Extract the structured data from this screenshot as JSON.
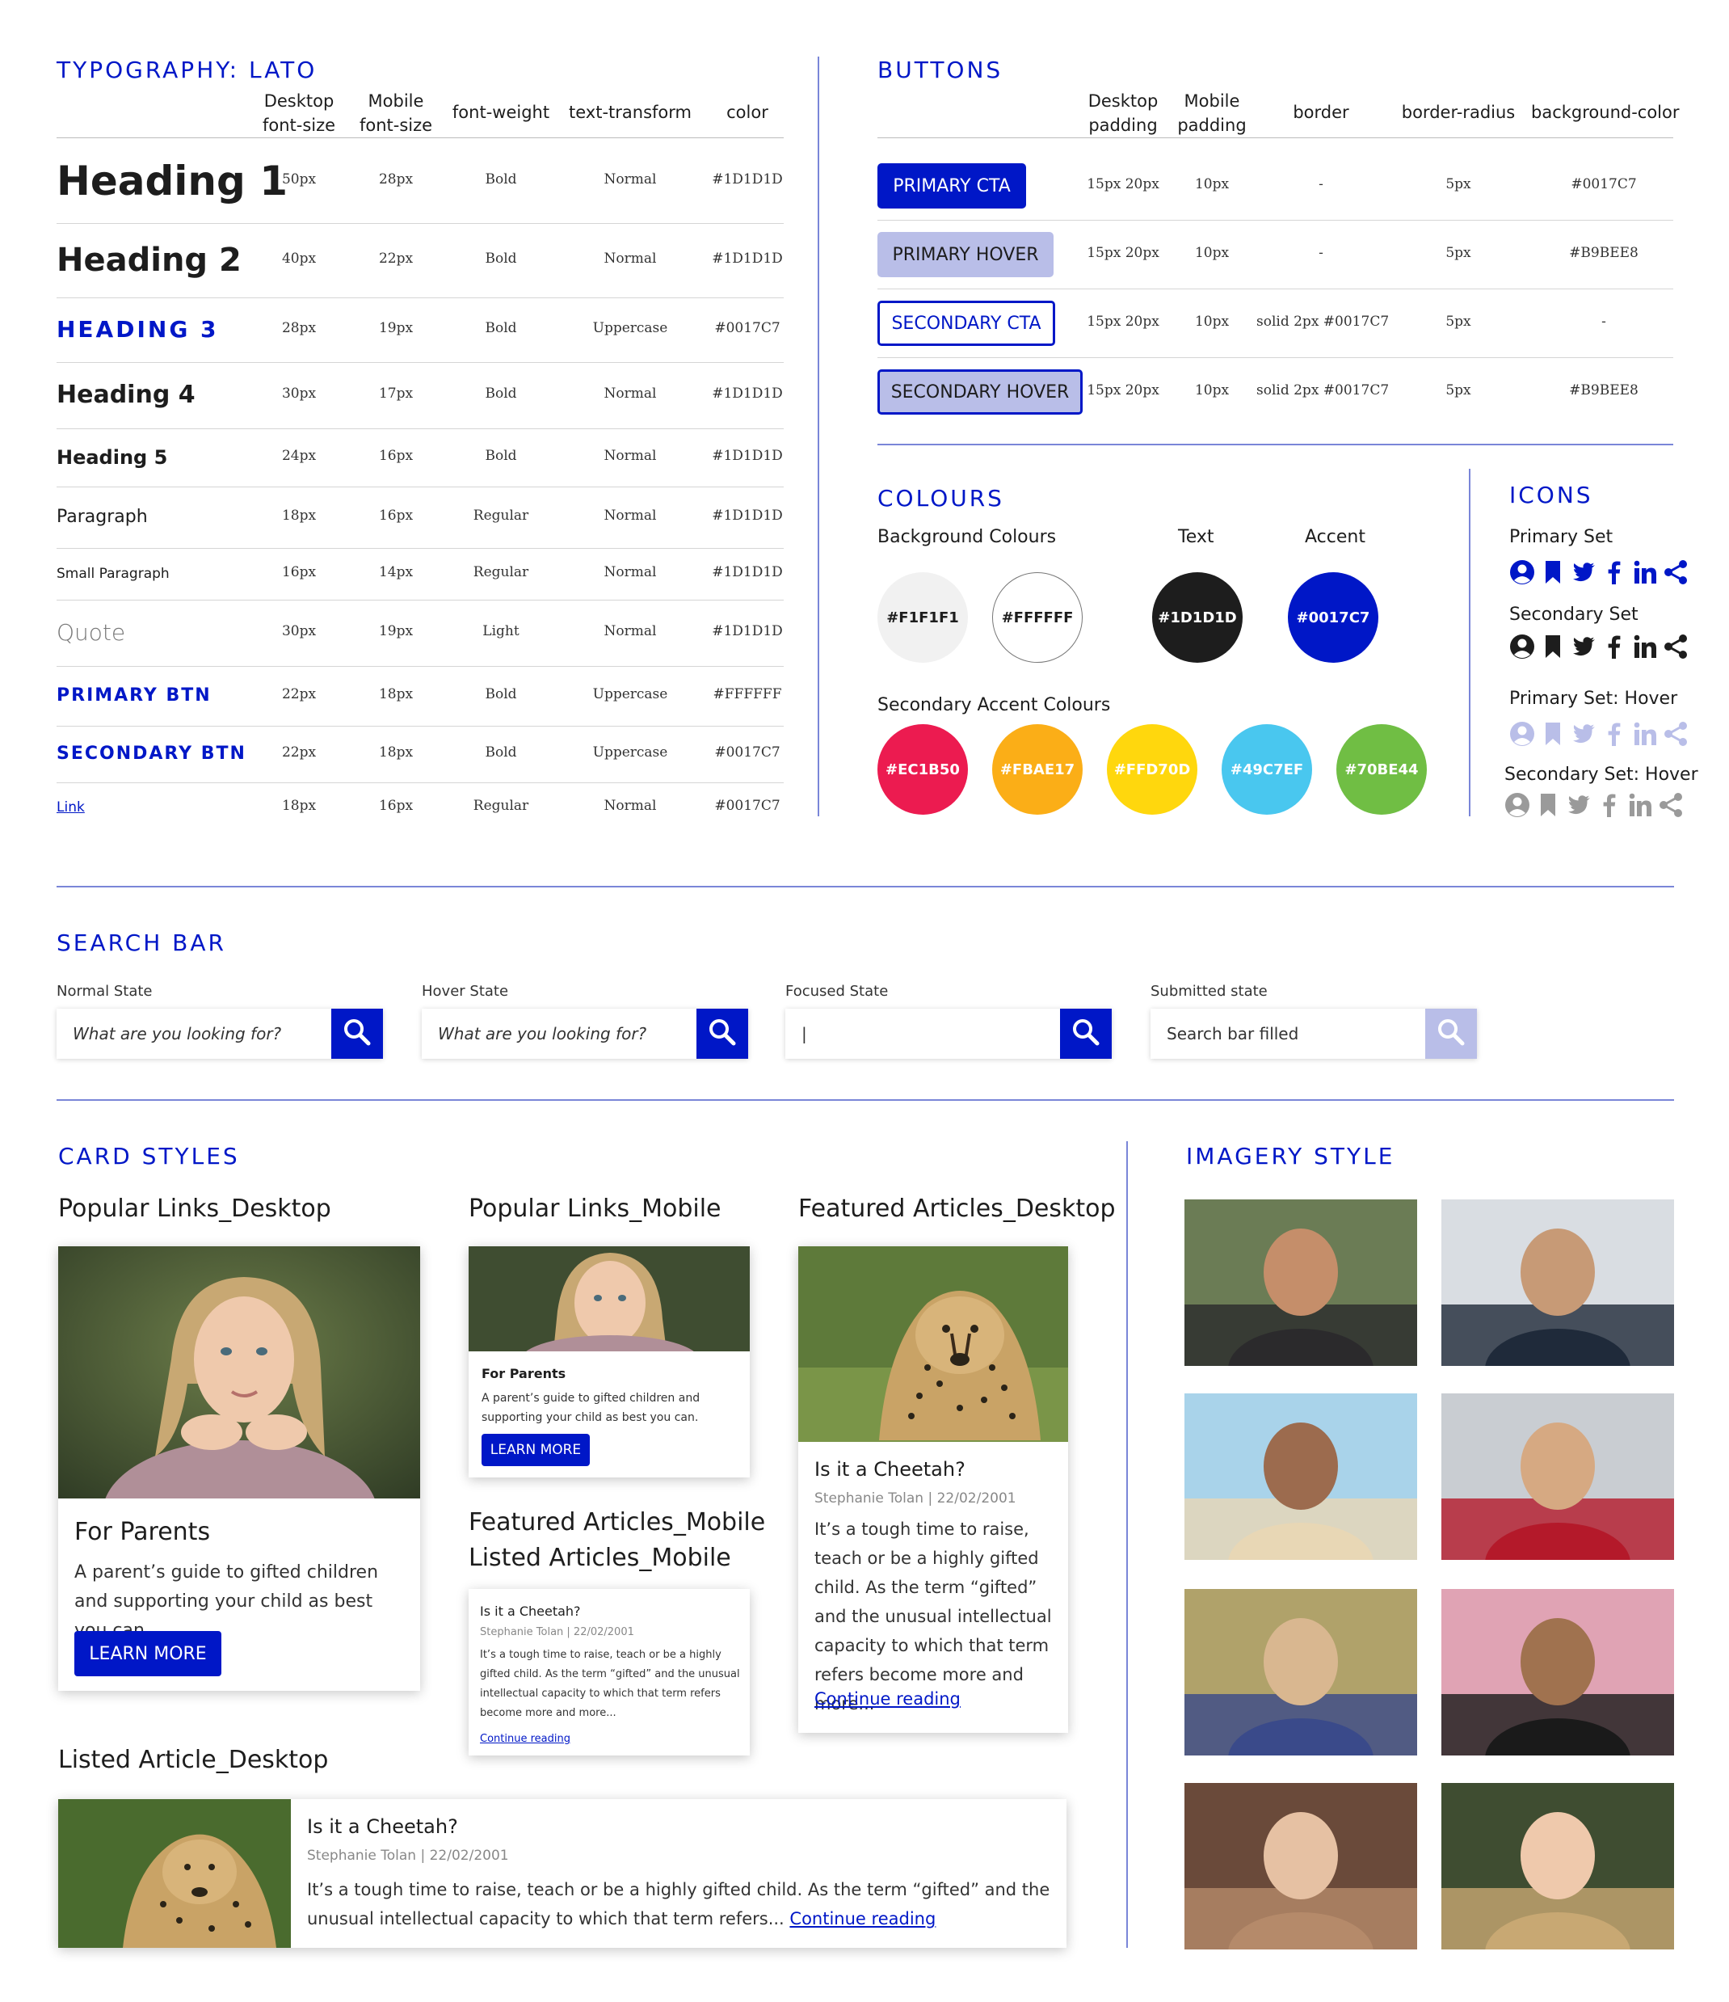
{
  "typography": {
    "title": "TYPOGRAPHY: LATO",
    "headers": {
      "desktop": "Desktop\nfont-size",
      "mobile": "Mobile\nfont-size",
      "weight": "font-weight",
      "transform": "text-transform",
      "color": "color"
    },
    "rows": [
      {
        "name": "Heading 1",
        "desktop": "50px",
        "mobile": "28px",
        "weight": "Bold",
        "transform": "Normal",
        "color": "#1D1D1D"
      },
      {
        "name": "Heading 2",
        "desktop": "40px",
        "mobile": "22px",
        "weight": "Bold",
        "transform": "Normal",
        "color": "#1D1D1D"
      },
      {
        "name": "HEADING 3",
        "desktop": "28px",
        "mobile": "19px",
        "weight": "Bold",
        "transform": "Uppercase",
        "color": "#0017C7"
      },
      {
        "name": "Heading 4",
        "desktop": "30px",
        "mobile": "17px",
        "weight": "Bold",
        "transform": "Normal",
        "color": "#1D1D1D"
      },
      {
        "name": "Heading 5",
        "desktop": "24px",
        "mobile": "16px",
        "weight": "Bold",
        "transform": "Normal",
        "color": "#1D1D1D"
      },
      {
        "name": "Paragraph",
        "desktop": "18px",
        "mobile": "16px",
        "weight": "Regular",
        "transform": "Normal",
        "color": "#1D1D1D"
      },
      {
        "name": "Small Paragraph",
        "desktop": "16px",
        "mobile": "14px",
        "weight": "Regular",
        "transform": "Normal",
        "color": "#1D1D1D"
      },
      {
        "name": "Quote",
        "desktop": "30px",
        "mobile": "19px",
        "weight": "Light",
        "transform": "Normal",
        "color": "#1D1D1D"
      },
      {
        "name": "PRIMARY BTN",
        "desktop": "22px",
        "mobile": "18px",
        "weight": "Bold",
        "transform": "Uppercase",
        "color": "#FFFFFF"
      },
      {
        "name": "SECONDARY BTN",
        "desktop": "22px",
        "mobile": "18px",
        "weight": "Bold",
        "transform": "Uppercase",
        "color": "#0017C7"
      },
      {
        "name": "Link",
        "desktop": "18px",
        "mobile": "16px",
        "weight": "Regular",
        "transform": "Normal",
        "color": "#0017C7"
      }
    ]
  },
  "buttons": {
    "title": "BUTTONS",
    "headers": {
      "desktop": "Desktop\npadding",
      "mobile": "Mobile\npadding",
      "border": "border",
      "radius": "border-radius",
      "bg": "background-color"
    },
    "rows": [
      {
        "label": "PRIMARY CTA",
        "desktop": "15px 20px",
        "mobile": "10px",
        "border": "-",
        "radius": "5px",
        "bg": "#0017C7"
      },
      {
        "label": "PRIMARY HOVER",
        "desktop": "15px 20px",
        "mobile": "10px",
        "border": "-",
        "radius": "5px",
        "bg": "#B9BEE8"
      },
      {
        "label": "SECONDARY CTA",
        "desktop": "15px 20px",
        "mobile": "10px",
        "border": "solid 2px #0017C7",
        "radius": "5px",
        "bg": "-"
      },
      {
        "label": "SECONDARY HOVER",
        "desktop": "15px 20px",
        "mobile": "10px",
        "border": "solid 2px #0017C7",
        "radius": "5px",
        "bg": "#B9BEE8"
      }
    ]
  },
  "colours": {
    "title": "COLOURS",
    "bg_label": "Background Colours",
    "text_label": "Text",
    "accent_label": "Accent",
    "secondary_label": "Secondary Accent Colours",
    "background": [
      "#F1F1F1",
      "#FFFFFF"
    ],
    "text": "#1D1D1D",
    "accent": "#0017C7",
    "secondary": [
      "#EC1B50",
      "#FBAE17",
      "#FFD70D",
      "#49C7EF",
      "#70BE44"
    ]
  },
  "icons": {
    "title": "ICONS",
    "sets": [
      {
        "label": "Primary Set",
        "color": "#0017C7"
      },
      {
        "label": "Secondary Set",
        "color": "#1D1D1D"
      },
      {
        "label": "Primary Set: Hover",
        "color": "#B9BEE8"
      },
      {
        "label": "Secondary Set: Hover",
        "color": "#9a9a9a"
      }
    ],
    "names": [
      "user-icon",
      "bookmark-icon",
      "twitter-icon",
      "facebook-icon",
      "linkedin-icon",
      "share-icon"
    ]
  },
  "search": {
    "title": "SEARCH BAR",
    "states": [
      {
        "label": "Normal State",
        "text": "What are you looking for?",
        "placeholder": true,
        "btn": "#0017C7"
      },
      {
        "label": "Hover State",
        "text": "What are you looking for?",
        "placeholder": true,
        "btn": "#0017C7"
      },
      {
        "label": "Focused State",
        "text": "|",
        "placeholder": false,
        "btn": "#0017C7"
      },
      {
        "label": "Submitted state",
        "text": "Search bar filled",
        "placeholder": false,
        "btn": "#B9BEE8"
      }
    ]
  },
  "cards": {
    "title": "CARD STYLES",
    "popular_desktop": {
      "label": "Popular Links_Desktop",
      "heading": "For Parents",
      "body": "A parent’s guide to gifted children and supporting your child as best you can.",
      "button": "LEARN MORE"
    },
    "popular_mobile": {
      "label": "Popular Links_Mobile",
      "heading": "For Parents",
      "body": "A parent’s guide to gifted children and supporting your child as best you can.",
      "button": "LEARN MORE"
    },
    "featured_desktop": {
      "label": "Featured Articles_Desktop",
      "heading": "Is it a Cheetah?",
      "meta": "Stephanie Tolan | 22/02/2001",
      "body": "It’s a tough time to raise, teach or be a highly gifted child. As the term “gifted” and the unusual intellectual capacity to which that term refers become more and more...",
      "link": "Continue reading"
    },
    "featured_mobile": {
      "label1": "Featured Articles_Mobile",
      "label2": "Listed Articles_Mobile",
      "heading": "Is it a Cheetah?",
      "meta": "Stephanie Tolan | 22/02/2001",
      "body": "It’s a tough time to raise, teach or be a highly gifted child. As the term “gifted” and the unusual intellectual capacity to which that term refers become more and more...",
      "link": "Continue reading"
    },
    "listed_desktop": {
      "label": "Listed Article_Desktop",
      "heading": "Is it a Cheetah?",
      "meta": "Stephanie Tolan | 22/02/2001",
      "body": "It’s a tough time to raise, teach or be a highly gifted child. As the term “gifted” and the unusual intellectual capacity to which that term refers...",
      "link": "Continue reading"
    }
  },
  "imagery": {
    "title": "IMAGERY STYLE"
  }
}
